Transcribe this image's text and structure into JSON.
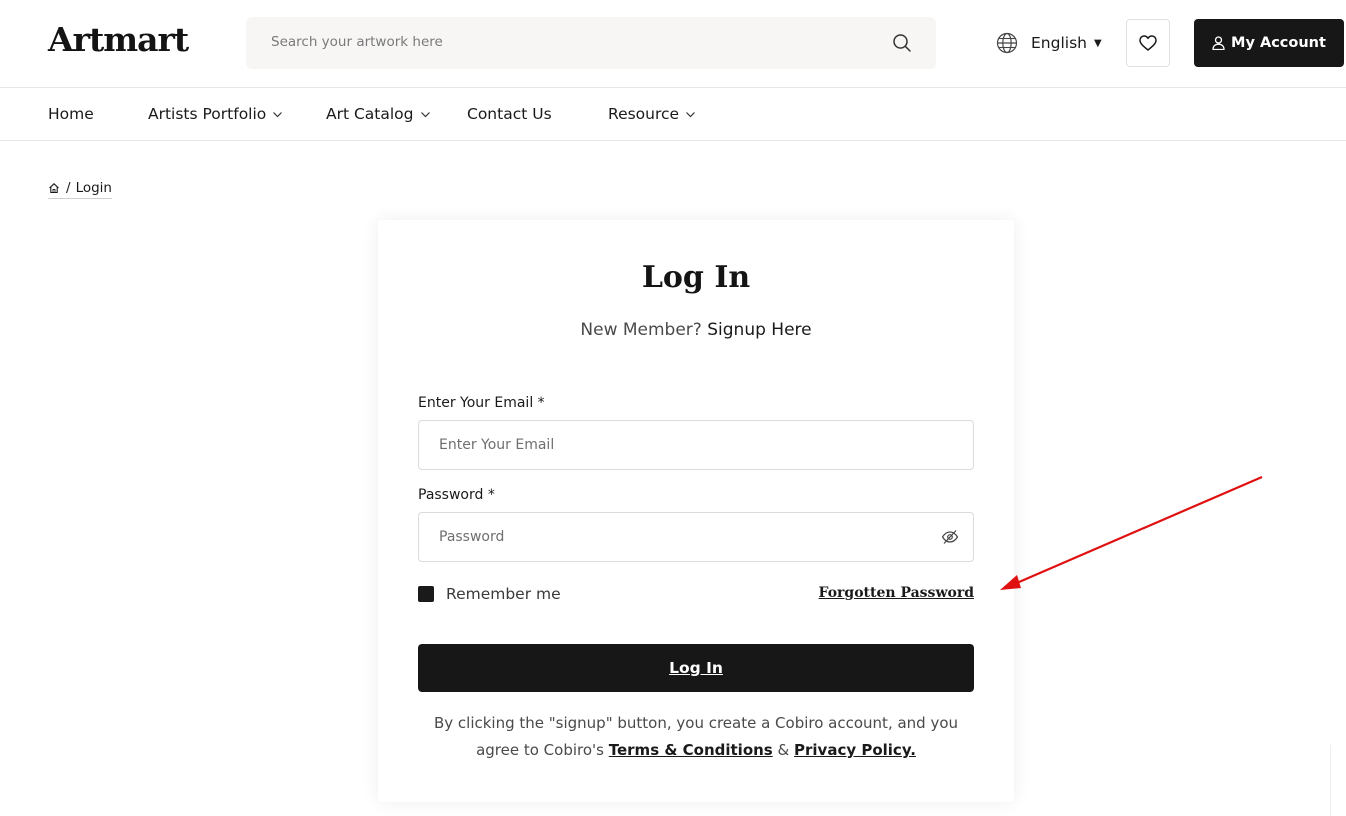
{
  "header": {
    "logo": "Artmart",
    "search_placeholder": "Search your artwork here",
    "language": "English",
    "account_label": "My Account"
  },
  "nav": {
    "items": [
      {
        "label": "Home",
        "has_dropdown": false
      },
      {
        "label": "Artists Portfolio",
        "has_dropdown": true
      },
      {
        "label": "Art Catalog",
        "has_dropdown": true
      },
      {
        "label": "Contact Us",
        "has_dropdown": false
      },
      {
        "label": "Resource",
        "has_dropdown": true
      }
    ]
  },
  "breadcrumb": {
    "separator": "/",
    "current": "Login"
  },
  "login": {
    "title": "Log In",
    "new_member_text": "New Member?",
    "signup_link": "Signup Here",
    "email_label": "Enter Your Email *",
    "email_placeholder": "Enter Your Email",
    "password_label": "Password *",
    "password_placeholder": "Password",
    "remember_label": "Remember me",
    "forgot_link": "Forgotten Password",
    "submit_label": "Log In",
    "terms_text_1": "By clicking the \"signup\" button, you create a Cobiro account, and you agree to Cobiro's",
    "terms_link": "Terms & Conditions",
    "terms_and": "&",
    "privacy_link": "Privacy Policy."
  },
  "colors": {
    "primary": "#171717",
    "annotation": "#e01010"
  }
}
